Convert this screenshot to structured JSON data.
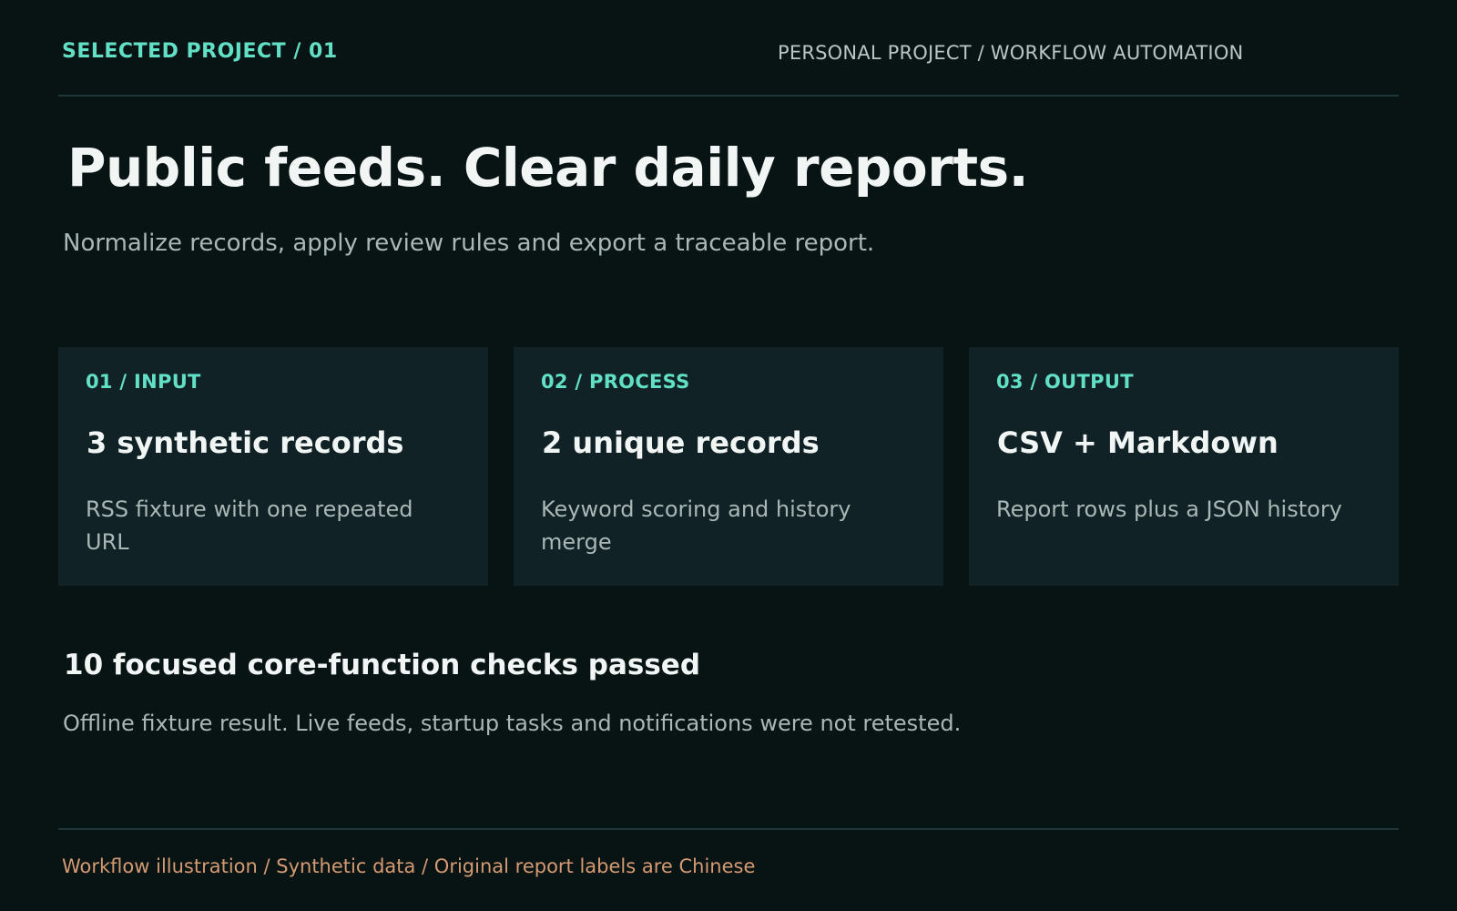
{
  "header": {
    "eyebrow": "SELECTED PROJECT / 01",
    "meta": "PERSONAL PROJECT / WORKFLOW AUTOMATION"
  },
  "hero": {
    "title": "Public feeds. Clear daily reports.",
    "subtitle": "Normalize records, apply review rules and export a traceable report."
  },
  "cards": [
    {
      "label": "01 / INPUT",
      "title": "3 synthetic records",
      "description": "RSS fixture with one repeated URL"
    },
    {
      "label": "02 / PROCESS",
      "title": "2 unique records",
      "description": "Keyword scoring and history merge"
    },
    {
      "label": "03 / OUTPUT",
      "title": "CSV + Markdown",
      "description": "Report rows plus a JSON history"
    }
  ],
  "result": {
    "title": "10 focused core-function checks passed",
    "description": "Offline fixture result. Live feeds, startup tasks and notifications were not retested."
  },
  "footer": {
    "note": "Workflow illustration / Synthetic data / Original report labels are Chinese"
  },
  "colors": {
    "background": "#081314",
    "card": "#102226",
    "accent": "#62e0c6",
    "footer": "#d49a72"
  }
}
